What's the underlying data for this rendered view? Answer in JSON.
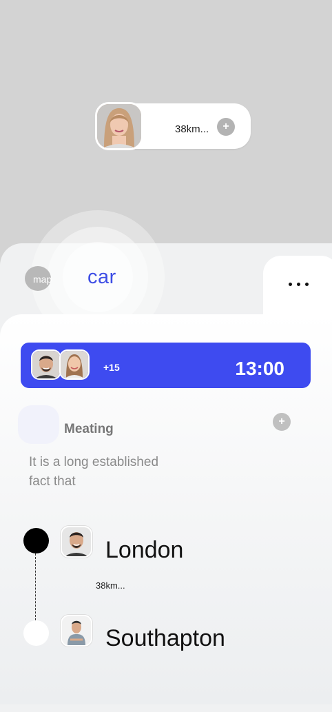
{
  "map": {
    "driver_distance": "38km...",
    "add_symbol": "+"
  },
  "mode_switch": {
    "map_label": "map",
    "car_label": "car"
  },
  "banner": {
    "extra_count": "+15",
    "time": "13:00",
    "color": "#3e4bf0"
  },
  "event": {
    "title": "Meating",
    "description": "It is a long established fact that",
    "add_symbol": "+"
  },
  "route": {
    "stops": [
      {
        "name": "London"
      },
      {
        "name": "Southapton"
      }
    ],
    "distance": "38km..."
  },
  "icons": [
    "more-dots-icon",
    "plus-icon",
    "avatar"
  ]
}
